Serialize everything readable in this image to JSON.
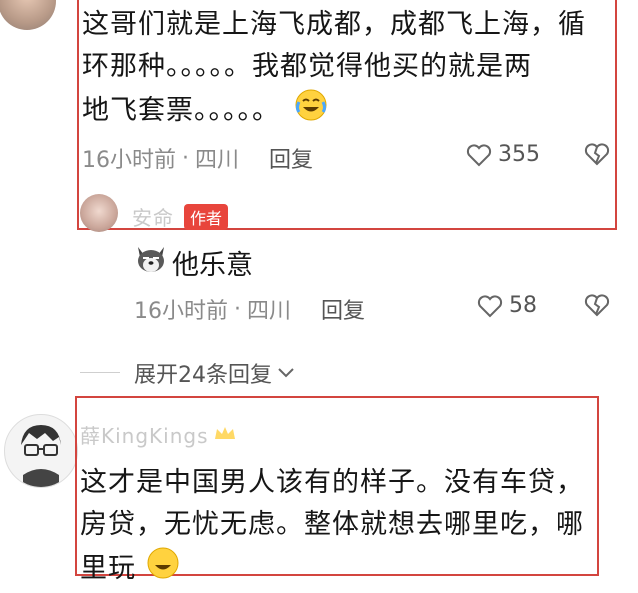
{
  "comment1": {
    "lines": [
      "这哥们就是上海飞成都，成都飞上海，循",
      "环那种。。。。。我都觉得他买的就是两",
      "地飞套票。。。。。"
    ],
    "time": "16小时前",
    "location": "四川",
    "reply_label": "回复",
    "likes": "355"
  },
  "author_reply": {
    "name": "安命",
    "badge": "作者",
    "text": "他乐意",
    "time": "16小时前",
    "location": "四川",
    "reply_label": "回复",
    "likes": "58"
  },
  "expand": {
    "label": "展开24条回复"
  },
  "comment2": {
    "name": "薛KingKings",
    "lines": [
      "这才是中国男人该有的样子。没有车贷，",
      "房贷，无忧无虑。整体就想去哪里吃，哪",
      "里玩"
    ]
  },
  "colors": {
    "highlight_box": "#d3453f",
    "badge": "#e8453c",
    "meta_text": "#8a8a8a"
  },
  "icons": [
    "laugh-cry-emoji",
    "heart-icon",
    "dislike-heart-icon",
    "dog-emoji",
    "chevron-down-icon"
  ]
}
